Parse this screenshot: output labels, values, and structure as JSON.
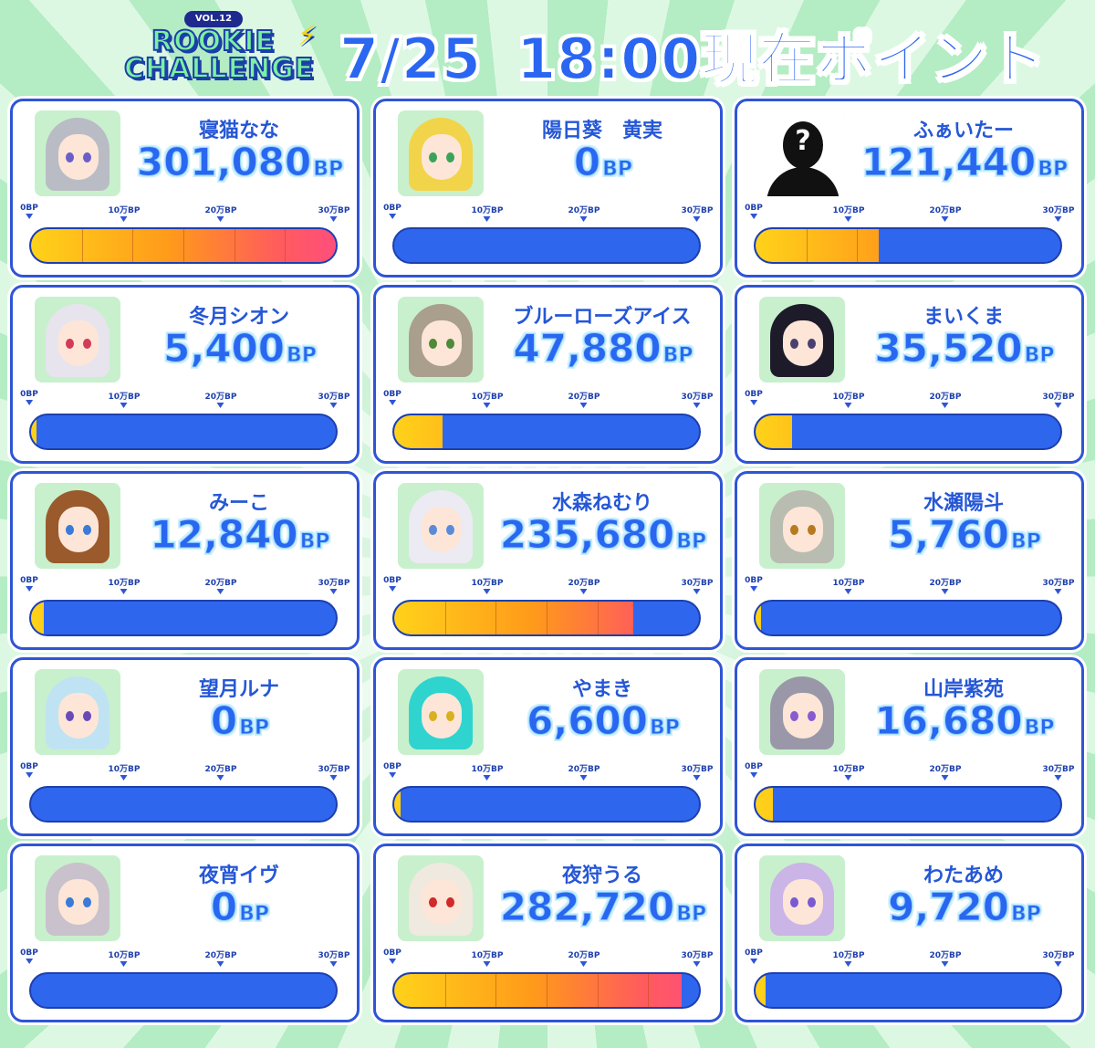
{
  "header": {
    "logo_vol": "VOL.12",
    "logo_line1": "ROOKIE",
    "logo_line2": "CHALLENGE",
    "date": "7/25",
    "title_rest": "18:00現在ポイント"
  },
  "scale": {
    "max_bp": 300000,
    "ticks": [
      "0BP",
      "10万BP",
      "20万BP",
      "30万BP"
    ]
  },
  "colors": {
    "primary_blue": "#2a66f0",
    "border_blue": "#2f55d6",
    "fill_start": "#ffd21a",
    "fill_end": "#ff4d7e"
  },
  "contestants": [
    {
      "name": "寝猫なな",
      "points": "301,080",
      "unit": "BP",
      "value": 301080,
      "hair": "#b9bcc4",
      "eye": "#6a5fc8"
    },
    {
      "name": "陽日葵　黄実",
      "points": "0",
      "unit": "BP",
      "value": 0,
      "hair": "#f2d44a",
      "eye": "#3aa35a"
    },
    {
      "name": "ふぁいたー",
      "points": "121,440",
      "unit": "BP",
      "value": 121440,
      "hair": "unknown",
      "eye": "",
      "unknown_glyph": "?"
    },
    {
      "name": "冬月シオン",
      "points": "5,400",
      "unit": "BP",
      "value": 5400,
      "hair": "#e7e4ee",
      "eye": "#d33a5a"
    },
    {
      "name": "ブルーローズアイス",
      "points": "47,880",
      "unit": "BP",
      "value": 47880,
      "hair": "#a99f8c",
      "eye": "#4e8a3a"
    },
    {
      "name": "まいくま",
      "points": "35,520",
      "unit": "BP",
      "value": 35520,
      "hair": "#1d1b2a",
      "eye": "#4a3f6e"
    },
    {
      "name": "みーこ",
      "points": "12,840",
      "unit": "BP",
      "value": 12840,
      "hair": "#9a5a2c",
      "eye": "#3a7ad8"
    },
    {
      "name": "水森ねむり",
      "points": "235,680",
      "unit": "BP",
      "value": 235680,
      "hair": "#eceaf2",
      "eye": "#5a8ad8"
    },
    {
      "name": "水瀬陽斗",
      "points": "5,760",
      "unit": "BP",
      "value": 5760,
      "hair": "#b9bcb0",
      "eye": "#b87a20"
    },
    {
      "name": "望月ルナ",
      "points": "0",
      "unit": "BP",
      "value": 0,
      "hair": "#bfe3f2",
      "eye": "#6a4ab8"
    },
    {
      "name": "やまき",
      "points": "6,600",
      "unit": "BP",
      "value": 6600,
      "hair": "#2fd4cf",
      "eye": "#d8b020"
    },
    {
      "name": "山岸紫苑",
      "points": "16,680",
      "unit": "BP",
      "value": 16680,
      "hair": "#9a98a8",
      "eye": "#8a5ad0"
    },
    {
      "name": "夜宵イヴ",
      "points": "0",
      "unit": "BP",
      "value": 0,
      "hair": "#c9c2cc",
      "eye": "#3a7ad8"
    },
    {
      "name": "夜狩うる",
      "points": "282,720",
      "unit": "BP",
      "value": 282720,
      "hair": "#efe9e0",
      "eye": "#d02a2a"
    },
    {
      "name": "わたあめ",
      "points": "9,720",
      "unit": "BP",
      "value": 9720,
      "hair": "#cbb4e6",
      "eye": "#7a5ad0"
    }
  ]
}
